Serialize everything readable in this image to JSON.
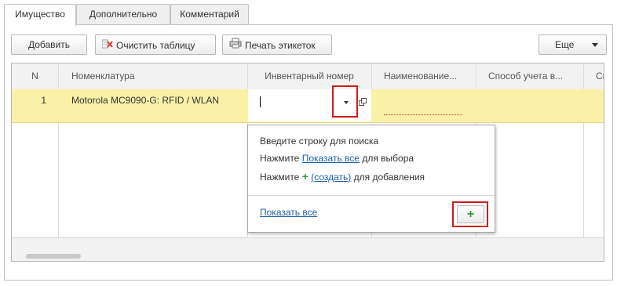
{
  "tabs": [
    {
      "label": "Имущество",
      "active": true
    },
    {
      "label": "Дополнительно",
      "active": false
    },
    {
      "label": "Комментарий",
      "active": false
    }
  ],
  "toolbar": {
    "add_label": "Добавить",
    "clear_label": "Очистить таблицу",
    "print_label": "Печать этикеток",
    "more_label": "Еще"
  },
  "table": {
    "columns": [
      "N",
      "Номенклатура",
      "Инвентарный номер",
      "Наименование...",
      "Способ учета в...",
      "Сп"
    ],
    "rows": [
      {
        "n": "1",
        "nomenclature": "Motorola MC9090-G: RFID / WLAN",
        "inventory": "",
        "name": "",
        "method": ""
      }
    ]
  },
  "dropdown": {
    "line1": "Введите строку для поиска",
    "line2_prefix": "Нажмите",
    "line2_link": "Показать все",
    "line2_suffix": "для выбора",
    "line3_prefix": "Нажмите",
    "line3_link": "(создать)",
    "line3_suffix": "для добавления",
    "show_all_link": "Показать все"
  },
  "colors": {
    "selected_row": "#fbf0a8",
    "link": "#1d5fa6",
    "highlight": "#d11a1a",
    "plus": "#2e9a3a"
  }
}
